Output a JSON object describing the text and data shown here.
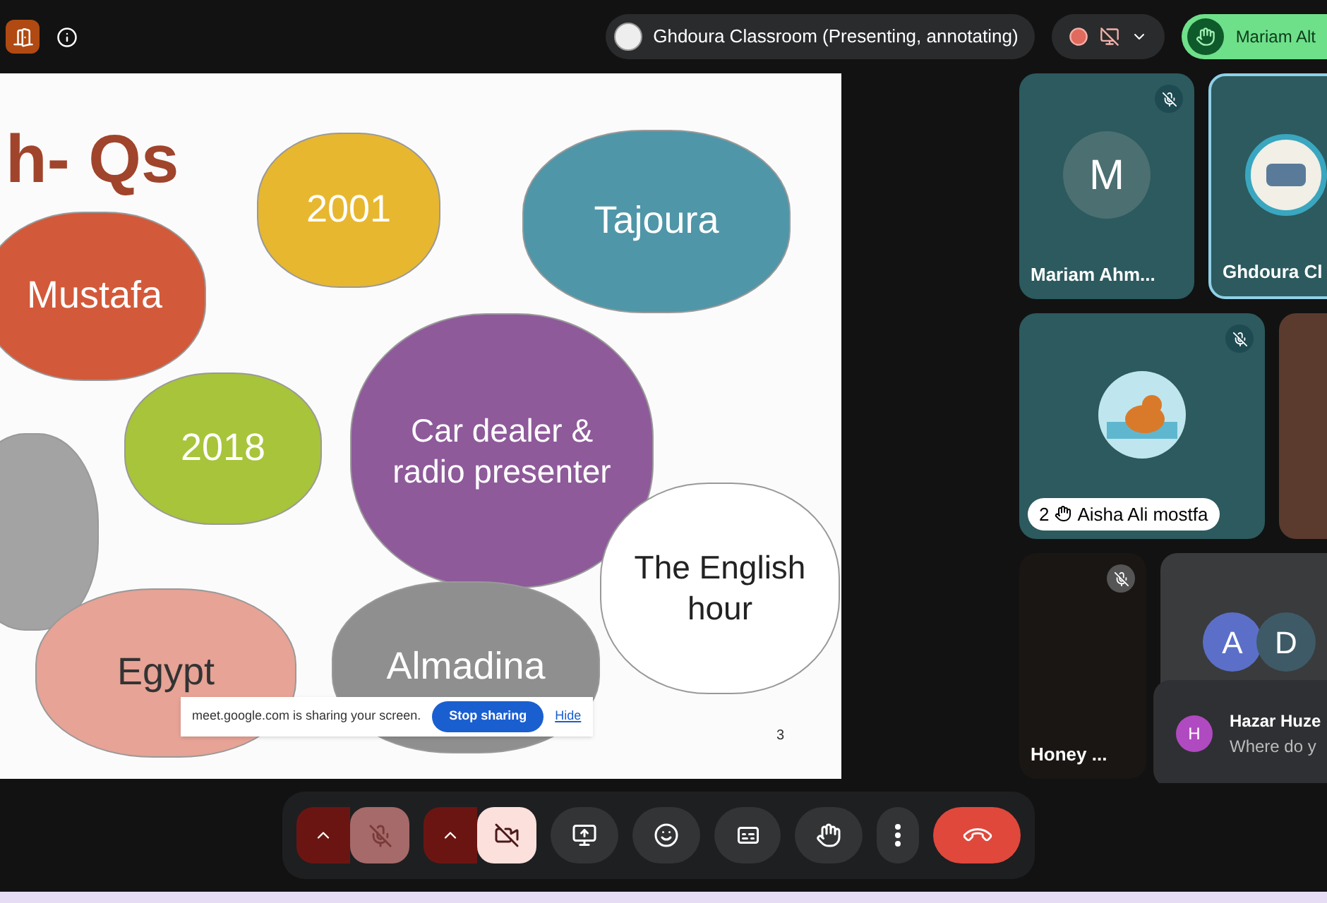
{
  "top_bar": {
    "meeting": "Ghdoura Classroom (Presenting, annotating)",
    "user_chip": "Mariam Alt"
  },
  "slide": {
    "title": "h- Qs",
    "page": "3",
    "clouds": [
      {
        "text": "2001",
        "color": "#e8b730"
      },
      {
        "text": "Tajoura",
        "color": "#4f96a8"
      },
      {
        "text": "Mustafa",
        "color": "#d2593a"
      },
      {
        "text": "2018",
        "color": "#a8c43a"
      },
      {
        "text": "Car dealer & radio presenter",
        "color": "#8e5a9a"
      },
      {
        "color": "#a3a3a3"
      },
      {
        "text": "The English hour",
        "color": "#ffffff"
      },
      {
        "text": "Egypt",
        "color": "#e6a396"
      },
      {
        "text": "Almadina",
        "color": "#8f8f8f"
      }
    ]
  },
  "share_bar": {
    "message": "meet.google.com is sharing your screen.",
    "stop": "Stop sharing",
    "hide": "Hide"
  },
  "tiles": [
    {
      "kind": "avatar",
      "name": "Mariam Ahm...",
      "initial": "M",
      "muted": true,
      "selected": false
    },
    {
      "kind": "logo",
      "name": "Ghdoura Cl",
      "muted": false,
      "selected": true
    },
    {
      "kind": "image",
      "name": "Aisha Ali mostfa",
      "hand_count": "2",
      "muted": true,
      "selected": false
    },
    {
      "kind": "video"
    },
    {
      "kind": "dark",
      "name": "Honey ...",
      "muted": true,
      "selected": false
    },
    {
      "kind": "group",
      "initials": [
        "A",
        "D"
      ],
      "muted": false,
      "selected": false
    }
  ],
  "chat": {
    "initial": "H",
    "sender": "Hazar Huze",
    "message": "Where do y"
  },
  "controls": {
    "mic_on": false,
    "camera_on": false
  }
}
